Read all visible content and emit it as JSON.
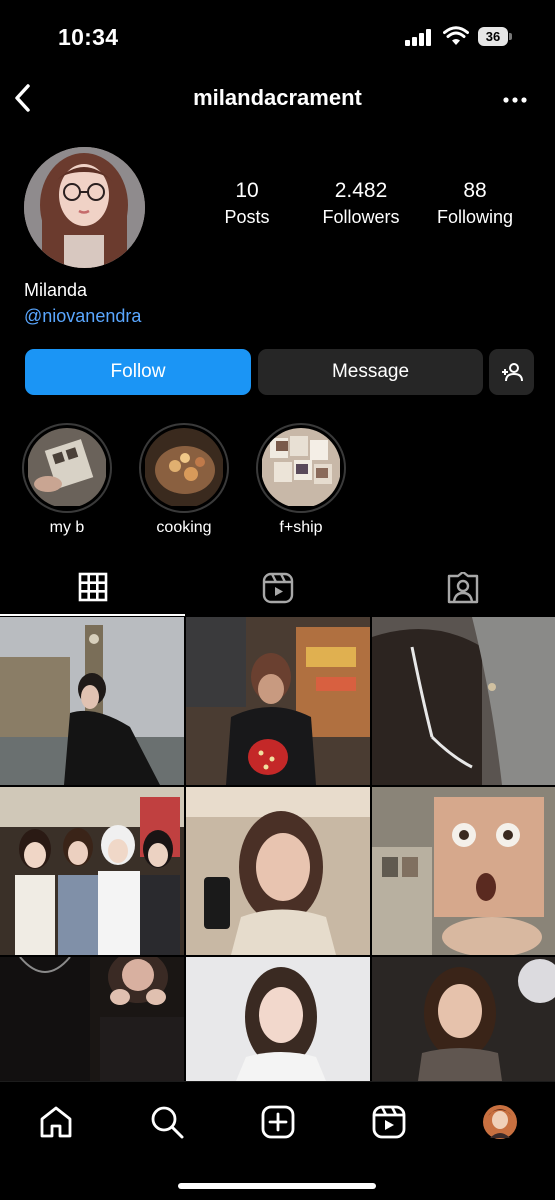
{
  "status_bar": {
    "time": "10:34",
    "battery": "36"
  },
  "header": {
    "username": "milandacrament"
  },
  "profile": {
    "display_name": "Milanda",
    "handle": "@niovanendra",
    "stats": [
      {
        "value": "10",
        "label": "Posts"
      },
      {
        "value": "2.482",
        "label": "Followers"
      },
      {
        "value": "88",
        "label": "Following"
      }
    ]
  },
  "actions": {
    "follow": "Follow",
    "message": "Message"
  },
  "highlights": [
    {
      "label": "my b"
    },
    {
      "label": "cooking"
    },
    {
      "label": "f+ship"
    }
  ],
  "tabs": [
    "grid-icon",
    "reels-icon",
    "tagged-icon"
  ],
  "bottom_nav": [
    "home-icon",
    "search-icon",
    "create-icon",
    "reels-icon",
    "profile-avatar"
  ],
  "colors": {
    "accent": "#1b95f5",
    "link": "#5aa7ff",
    "button_dark": "#262626"
  }
}
